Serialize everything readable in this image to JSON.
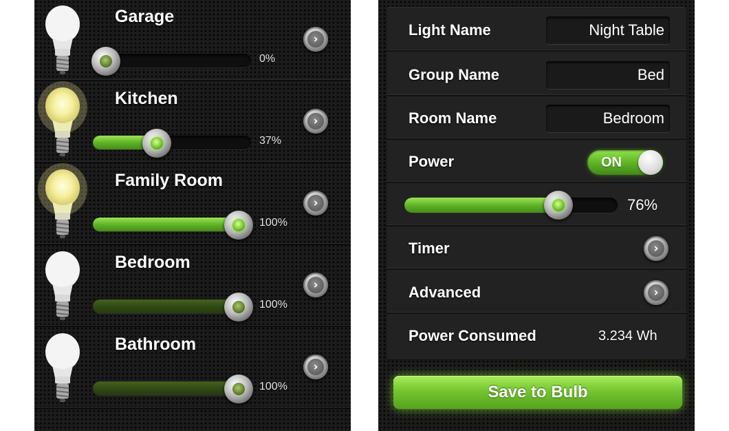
{
  "lights_list": {
    "items": [
      {
        "name": "Garage",
        "brightness_percent": 0,
        "brightness_label": "0%",
        "state": "off",
        "bulb_icon": "bulb-off-icon"
      },
      {
        "name": "Kitchen",
        "brightness_percent": 37,
        "brightness_label": "37%",
        "state": "on",
        "bulb_icon": "bulb-on-icon"
      },
      {
        "name": "Family Room",
        "brightness_percent": 100,
        "brightness_label": "100%",
        "state": "on",
        "bulb_icon": "bulb-on-icon"
      },
      {
        "name": "Bedroom",
        "brightness_percent": 100,
        "brightness_label": "100%",
        "state": "off",
        "bulb_icon": "bulb-off-icon"
      },
      {
        "name": "Bathroom",
        "brightness_percent": 100,
        "brightness_label": "100%",
        "state": "off",
        "bulb_icon": "bulb-off-icon"
      }
    ],
    "detail_icon": "chevron-right-icon"
  },
  "light_detail": {
    "light_name": {
      "label": "Light Name",
      "value": "Night Table"
    },
    "group_name": {
      "label": "Group Name",
      "value": "Bed"
    },
    "room_name": {
      "label": "Room Name",
      "value": "Bedroom"
    },
    "power": {
      "label": "Power",
      "toggle_label": "ON",
      "is_on": true
    },
    "brightness": {
      "percent": 76,
      "label": "76%"
    },
    "timer": {
      "label": "Timer"
    },
    "advanced": {
      "label": "Advanced"
    },
    "power_consumed": {
      "label": "Power Consumed",
      "value": "3.234 Wh"
    },
    "save_button_label": "Save to Bulb"
  },
  "colors": {
    "panel_background": "#1c1c1c",
    "accent_green": "#74c630",
    "dim_green": "#2e4714",
    "text": "#ffffff"
  }
}
